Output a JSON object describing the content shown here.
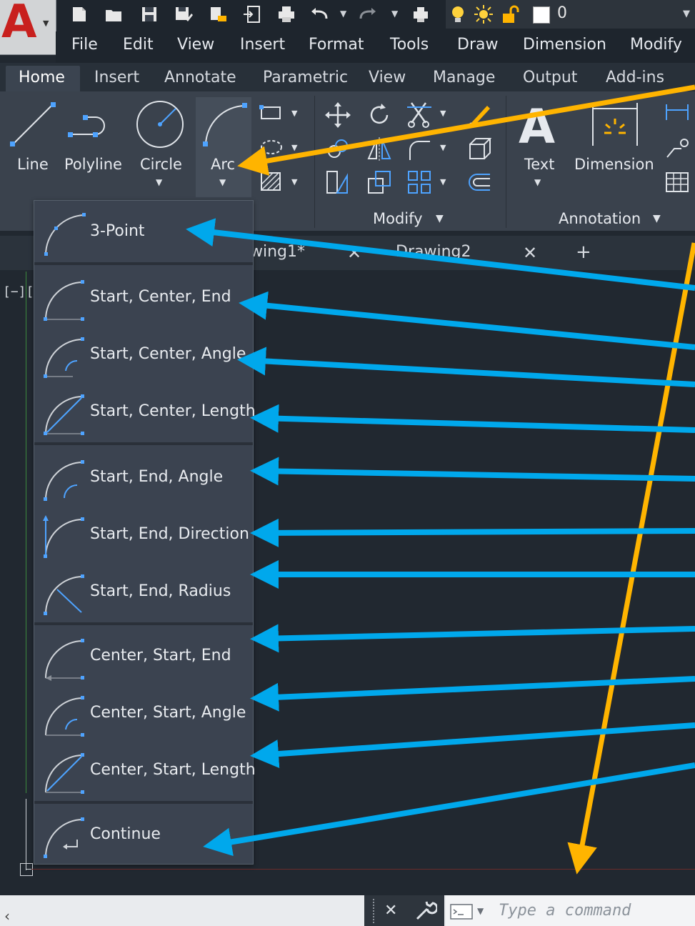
{
  "app": {
    "logo_letter": "A"
  },
  "quick_access": {
    "layer_value": "0"
  },
  "menu": [
    "File",
    "Edit",
    "View",
    "Insert",
    "Format",
    "Tools",
    "Draw",
    "Dimension",
    "Modify"
  ],
  "ribbon_tabs": [
    "Home",
    "Insert",
    "Annotate",
    "Parametric",
    "View",
    "Manage",
    "Output",
    "Add-ins"
  ],
  "ribbon": {
    "draw_tools": [
      "Line",
      "Polyline",
      "Circle",
      "Arc"
    ],
    "modify_panel": "Modify",
    "annotation_tools": [
      "Text",
      "Dimension"
    ],
    "annotation_panel": "Annotation"
  },
  "doc_tabs": [
    {
      "label": "wing1*",
      "close": "✕"
    },
    {
      "label": "Drawing2",
      "close": "✕"
    }
  ],
  "new_tab": "+",
  "viewport_label": "[−][",
  "arc_dropdown": {
    "groups": [
      [
        "3-Point"
      ],
      [
        "Start, Center, End",
        "Start, Center, Angle",
        "Start, Center, Length"
      ],
      [
        "Start, End, Angle",
        "Start, End, Direction",
        "Start, End, Radius"
      ],
      [
        "Center, Start, End",
        "Center, Start, Angle",
        "Center, Start, Length"
      ],
      [
        "Continue"
      ]
    ]
  },
  "command_line": {
    "placeholder": "Type a command",
    "prompt_icon": "command-prompt-icon"
  },
  "colors": {
    "arc_arrow": "#ffb400",
    "option_arrows": "#00a8ec",
    "accent_icon": "#4ea3ff"
  }
}
